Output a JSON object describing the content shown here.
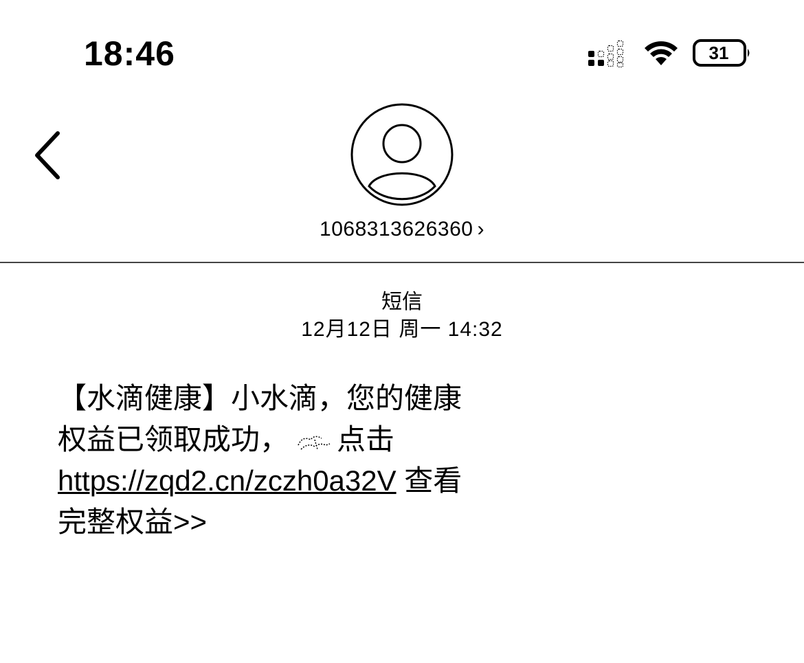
{
  "status_bar": {
    "time": "18:46",
    "battery_level": "31",
    "icons": [
      "cellular-signal-icon",
      "wifi-icon",
      "battery-icon"
    ]
  },
  "header": {
    "back_icon": "chevron-left-icon",
    "avatar_icon": "person-avatar-icon",
    "contact": "1068313626360",
    "contact_chevron": "›"
  },
  "thread": {
    "service_label": "短信",
    "timestamp": "12月12日 周一 14:32"
  },
  "message": {
    "line1": "【水滴健康】小水滴，您的健康",
    "line2_before": "权益已领取成功，",
    "line2_after": "点击",
    "link": "https://zqd2.cn/zczh0a32V",
    "line3_after": " 查看",
    "line4": "完整权益>>",
    "inline_icon": "sparkle-icon"
  },
  "colors": {
    "background": "#ffffff",
    "text": "#000000",
    "divider": "#444444"
  }
}
